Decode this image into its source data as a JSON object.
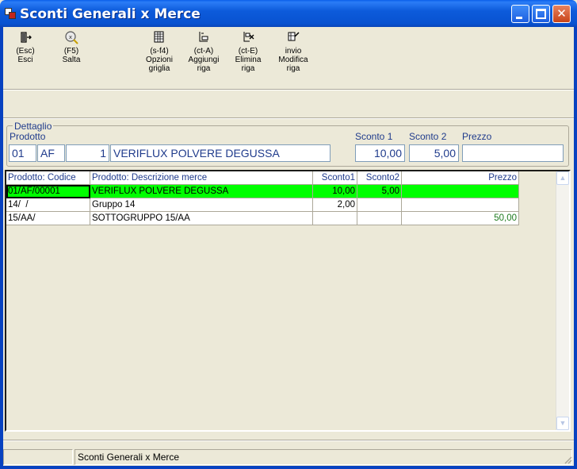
{
  "window": {
    "title": "Sconti Generali x Merce",
    "controls": {
      "minimize": "minimize-icon",
      "maximize": "maximize-icon",
      "close": "close-icon"
    }
  },
  "toolbar": {
    "items": [
      {
        "key": "(Esc)",
        "label": "Esci",
        "icon": "exit-door-icon"
      },
      {
        "key": "(F5)",
        "label": "Salta",
        "icon": "skip-magnifier-icon"
      },
      {
        "key": "(s-f4)",
        "label": "Opzioni",
        "label2": "griglia",
        "icon": "grid-options-icon"
      },
      {
        "key": "(ct-A)",
        "label": "Aggiungi",
        "label2": "riga",
        "icon": "add-row-icon"
      },
      {
        "key": "(ct-E)",
        "label": "Elimina",
        "label2": "riga",
        "icon": "delete-row-icon"
      },
      {
        "key": "invio",
        "label": "Modifica",
        "label2": "riga",
        "icon": "edit-row-icon"
      }
    ]
  },
  "detail": {
    "group_title": "Dettaglio",
    "prodotto_label": "Prodotto",
    "sconto1_label": "Sconto 1",
    "sconto2_label": "Sconto 2",
    "prezzo_label": "Prezzo",
    "prodotto_code1": "01",
    "prodotto_code2": "AF",
    "prodotto_code3": "1",
    "prodotto_desc": "VERIFLUX POLVERE DEGUSSA",
    "sconto1": "10,00",
    "sconto2": "5,00",
    "prezzo": ""
  },
  "grid": {
    "columns": [
      "Prodotto: Codice",
      "Prodotto: Descrizione merce",
      "Sconto1",
      "Sconto2",
      "Prezzo"
    ],
    "rows": [
      {
        "codice": "01/AF/00001",
        "descrizione": "VERIFLUX POLVERE DEGUSSA",
        "sconto1": "10,00",
        "sconto2": "5,00",
        "prezzo": ""
      },
      {
        "codice": "14/  /",
        "descrizione": "Gruppo 14",
        "sconto1": "2,00",
        "sconto2": "",
        "prezzo": ""
      },
      {
        "codice": "15/AA/",
        "descrizione": "SOTTOGRUPPO 15/AA",
        "sconto1": "",
        "sconto2": "",
        "prezzo": "50,00"
      }
    ],
    "selected_row_color": "#00FF00"
  },
  "status": {
    "panel1": "",
    "panel2": "Sconti Generali x Merce"
  },
  "colors": {
    "titlebar": "#0A5FEA",
    "label_blue": "#1F3B8C",
    "window_bg": "#ECE9D8"
  }
}
